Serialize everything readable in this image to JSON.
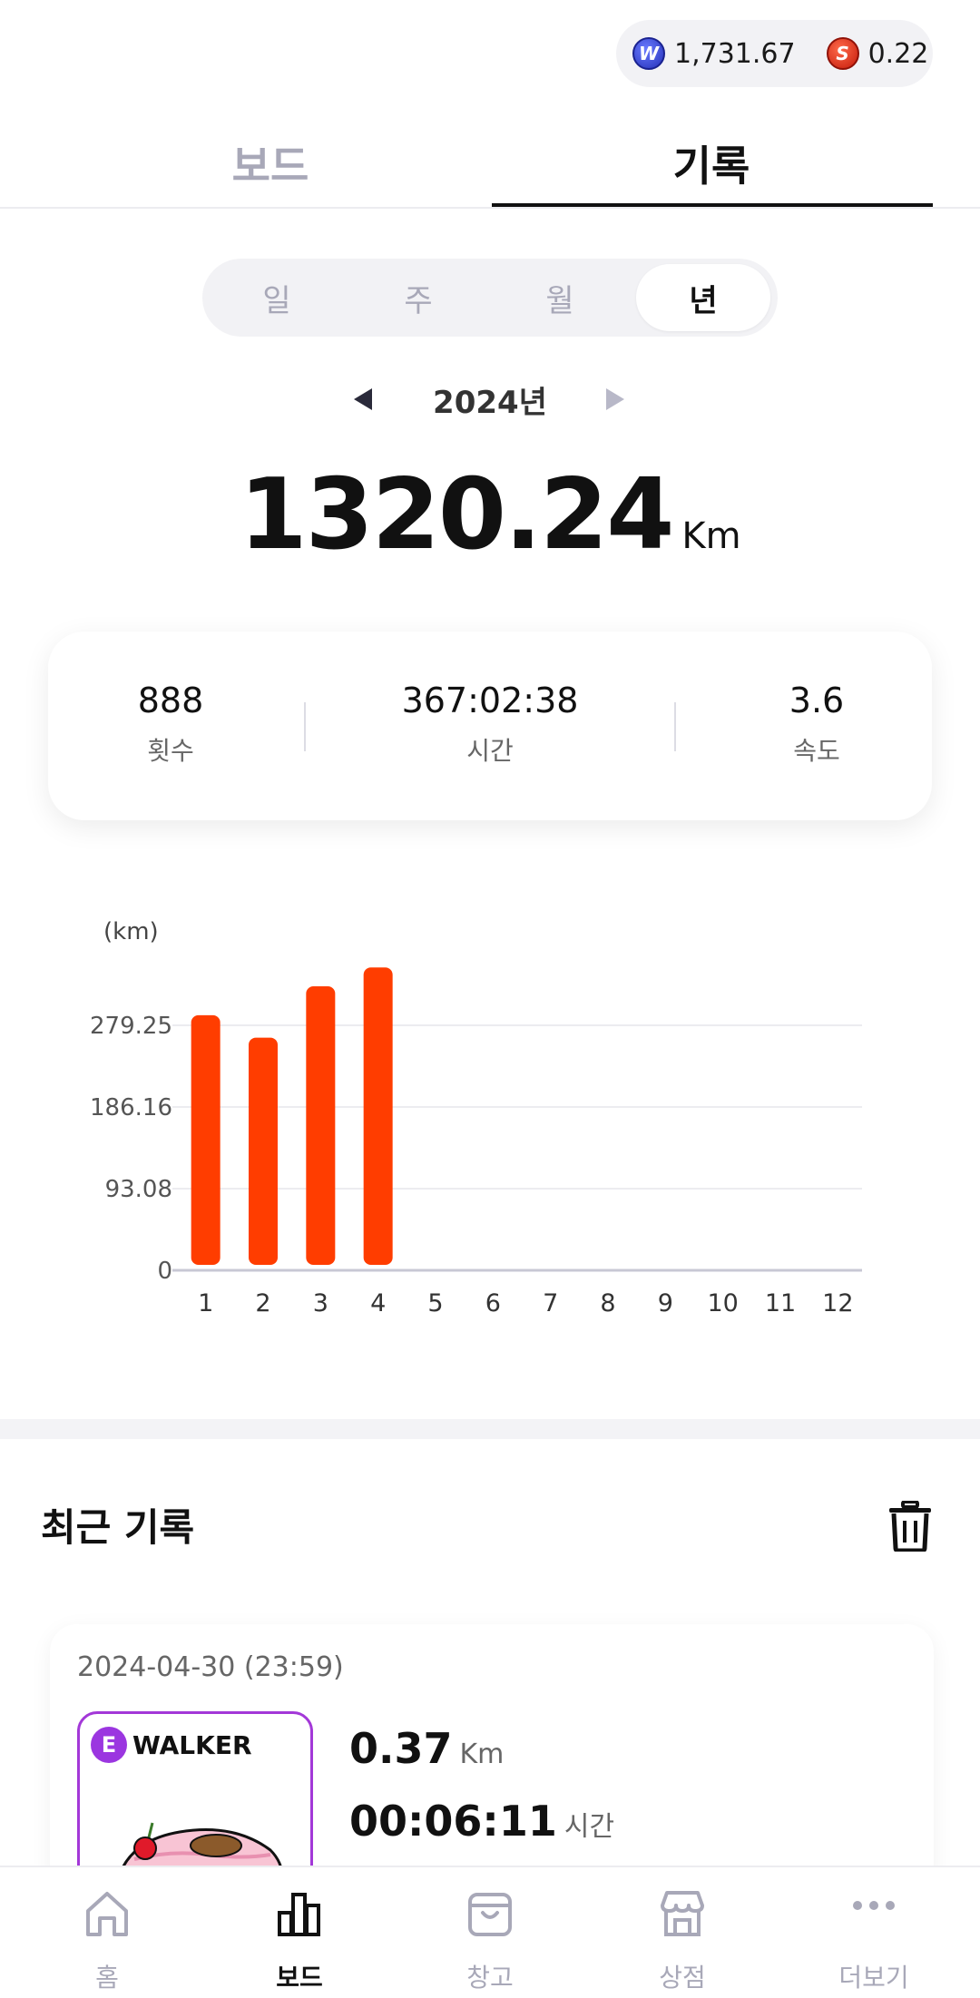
{
  "header": {
    "balance_w": "1,731.67",
    "balance_s": "0.22",
    "coin_w_letter": "W",
    "coin_s_letter": "S"
  },
  "tabs": {
    "board": "보드",
    "record": "기록",
    "active": "record"
  },
  "period": {
    "options": [
      "일",
      "주",
      "월",
      "년"
    ],
    "selected": "년"
  },
  "year": "2024년",
  "total": {
    "value": "1320.24",
    "unit": "Km"
  },
  "stats": [
    {
      "value": "888",
      "label": "횟수"
    },
    {
      "value": "367:02:38",
      "label": "시간"
    },
    {
      "value": "3.6",
      "label": "속도"
    }
  ],
  "chart_data": {
    "type": "bar",
    "ylabel": "(km)",
    "categories": [
      "1",
      "2",
      "3",
      "4",
      "5",
      "6",
      "7",
      "8",
      "9",
      "10",
      "11",
      "12"
    ],
    "values": [
      284.5,
      259.0,
      317.5,
      339.0,
      0,
      0,
      0,
      0,
      0,
      0,
      0,
      0
    ],
    "yticks": [
      "0",
      "93.08",
      "186.16",
      "279.25"
    ],
    "ylim": [
      0,
      279.25
    ],
    "color": "#ff3d00"
  },
  "recent": {
    "title": "최근 기록",
    "records": [
      {
        "date": "2024-04-30 (23:59)",
        "badge_letter": "E",
        "brand": "WALKER",
        "distance": "0.37",
        "distance_unit": "Km",
        "time": "00:06:11",
        "time_unit": "시간"
      }
    ]
  },
  "nav": [
    {
      "label": "홈",
      "icon": "home-icon"
    },
    {
      "label": "보드",
      "icon": "board-icon"
    },
    {
      "label": "창고",
      "icon": "bag-icon"
    },
    {
      "label": "상점",
      "icon": "store-icon"
    },
    {
      "label": "더보기",
      "icon": "more-icon"
    }
  ],
  "nav_active": "보드"
}
